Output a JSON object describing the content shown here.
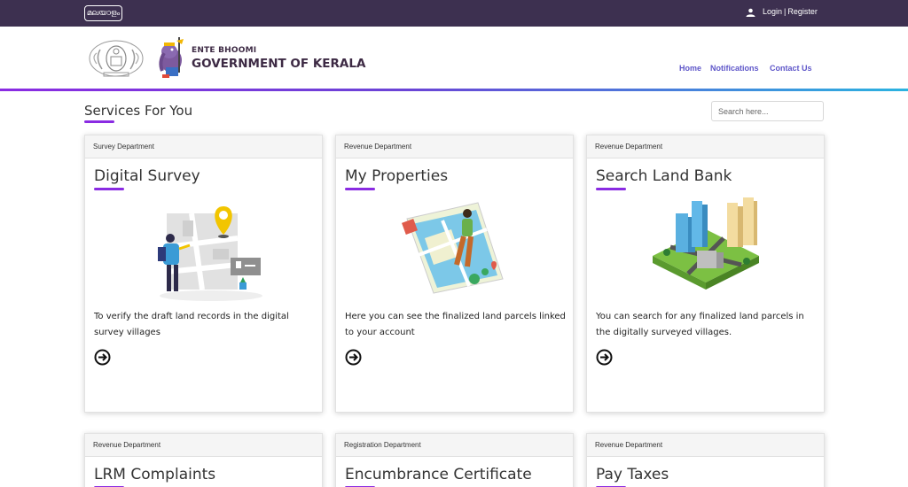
{
  "topbar": {
    "language_button": "മലയാളം",
    "login_label": "Login",
    "separator": "|",
    "register_label": "Register"
  },
  "header": {
    "brand_small": "ENTE BHOOMI",
    "brand_big": "GOVERNMENT OF KERALA",
    "nav": {
      "home": "Home",
      "notifications": "Notifications",
      "contact": "Contact Us"
    }
  },
  "section": {
    "title": "Services For You",
    "search_placeholder": "Search here..."
  },
  "cards": [
    {
      "department": "Survey Department",
      "title": "Digital Survey",
      "description": "To verify the draft land records in the digital survey villages",
      "icon": "map-pin-surveyor-illustration"
    },
    {
      "department": "Revenue Department",
      "title": "My Properties",
      "description": "Here you can see the finalized land parcels linked to your account",
      "icon": "map-explorer-illustration"
    },
    {
      "department": "Revenue Department",
      "title": "Search Land Bank",
      "description": "You can search for any finalized land parcels in the digitally surveyed villages.",
      "icon": "city-blocks-illustration"
    },
    {
      "department": "Revenue Department",
      "title": "LRM Complaints"
    },
    {
      "department": "Registration Department",
      "title": "Encumbrance Certificate"
    },
    {
      "department": "Revenue Department",
      "title": "Pay Taxes"
    }
  ],
  "colors": {
    "topbar": "#3d3050",
    "accent": "#8a2be2",
    "nav_link": "#5e56c9"
  }
}
